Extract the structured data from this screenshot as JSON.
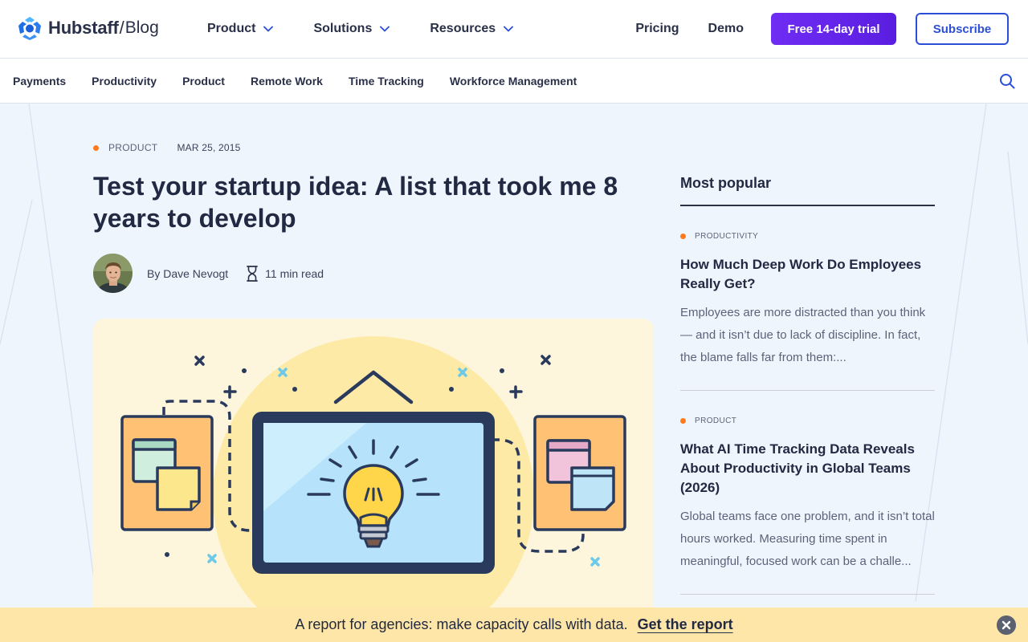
{
  "brand": {
    "name": "Hubstaff",
    "separator": "/",
    "section": "Blog"
  },
  "nav": {
    "items": [
      {
        "label": "Product"
      },
      {
        "label": "Solutions"
      },
      {
        "label": "Resources"
      }
    ],
    "pricing": "Pricing",
    "demo": "Demo",
    "trial": "Free 14-day trial",
    "subscribe": "Subscribe"
  },
  "categories": [
    "Payments",
    "Productivity",
    "Product",
    "Remote Work",
    "Time Tracking",
    "Workforce Management"
  ],
  "article": {
    "category": "PRODUCT",
    "date": "MAR 25, 2015",
    "title": "Test your startup idea: A list that took me 8 years to develop",
    "author": "By Dave Nevogt",
    "read_time": "11 min read"
  },
  "sidebar": {
    "heading": "Most popular",
    "cards": [
      {
        "category": "PRODUCTIVITY",
        "title": "How Much Deep Work Do Employees Really Get?",
        "excerpt": "Employees are more distracted than you think — and it isn’t due to lack of discipline. In fact, the blame falls far from them:..."
      },
      {
        "category": "PRODUCT",
        "title": "What AI Time Tracking Data Reveals About Productivity in Global Teams (2026)",
        "excerpt": "Global teams face one problem, and it isn’t total hours worked. Measuring time spent in meaningful, focused work can be a challe..."
      }
    ]
  },
  "banner": {
    "text": "A report for agencies: make capacity calls with data.",
    "link": "Get the report"
  },
  "colors": {
    "accent": "#6f2cf4",
    "link_blue": "#2a4fd6",
    "category_dot": "#ff7a1a",
    "banner_bg": "#fde6a8",
    "page_bg": "#eff5fd"
  },
  "icons": [
    "hubstaff-logo-icon",
    "chevron-down-icon",
    "search-icon",
    "hourglass-icon",
    "close-icon"
  ]
}
